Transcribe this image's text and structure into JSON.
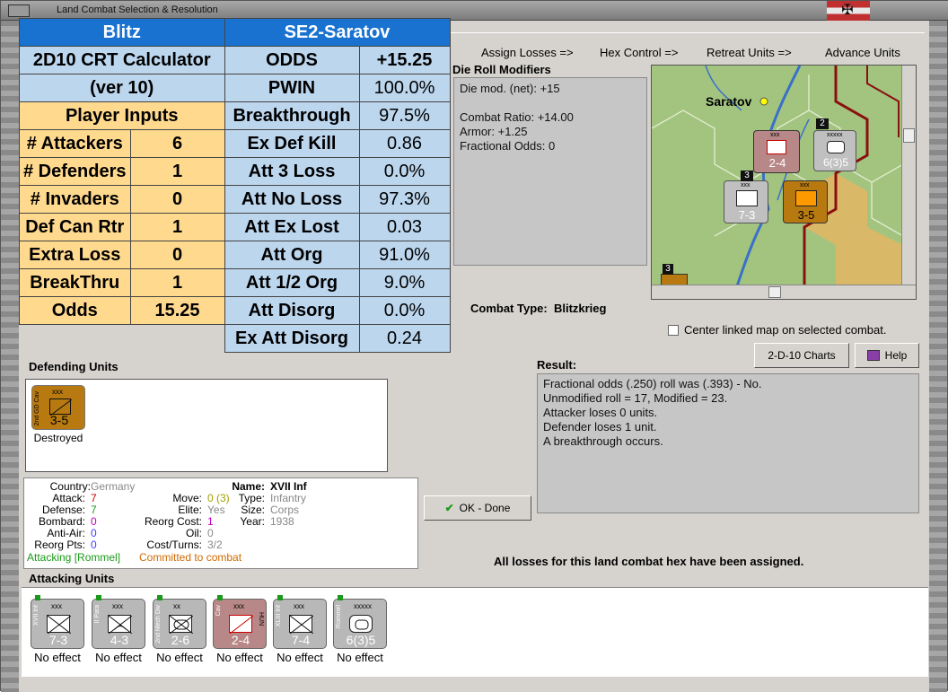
{
  "window": {
    "title": "Land Combat Selection & Resolution"
  },
  "calc": {
    "header_left": "Blitz",
    "header_right": "SE2-Saratov",
    "name_line1": "2D10 CRT Calculator",
    "name_line2": "(ver 10)",
    "inputs_header": "Player Inputs",
    "inputs": [
      {
        "label": "# Attackers",
        "value": "6"
      },
      {
        "label": "# Defenders",
        "value": "1"
      },
      {
        "label": "# Invaders",
        "value": "0"
      },
      {
        "label": "Def Can Rtr",
        "value": "1"
      },
      {
        "label": "Extra Loss",
        "value": "0"
      },
      {
        "label": "BreakThru",
        "value": "1"
      },
      {
        "label": "Odds",
        "value": "15.25"
      }
    ],
    "results": [
      {
        "label": "ODDS",
        "value": "+15.25"
      },
      {
        "label": "PWIN",
        "value": "100.0%"
      },
      {
        "label": "Breakthrough",
        "value": "97.5%"
      },
      {
        "label": "Ex Def Kill",
        "value": "0.86"
      },
      {
        "label": "Att 3 Loss",
        "value": "0.0%"
      },
      {
        "label": "Att No Loss",
        "value": "97.3%"
      },
      {
        "label": "Att Ex Lost",
        "value": "0.03"
      },
      {
        "label": "Att Org",
        "value": "91.0%"
      },
      {
        "label": "Att 1/2 Org",
        "value": "9.0%"
      },
      {
        "label": "Att Disorg",
        "value": "0.0%"
      },
      {
        "label": "Ex Att Disorg",
        "value": "0.24"
      }
    ]
  },
  "steps": [
    "Assign Losses =>",
    "Hex Control =>",
    "Retreat Units =>",
    "Advance Units"
  ],
  "drm": {
    "title": "Die Roll Modifiers",
    "lines": [
      "Die mod. (net): +15",
      "",
      "Combat Ratio: +14.00",
      "Armor: +1.25",
      "Fractional Odds: 0"
    ]
  },
  "map": {
    "city": "Saratov",
    "stack_counts": [
      "2",
      "3",
      "3"
    ],
    "units": [
      {
        "top": "xxx",
        "value": "2-4"
      },
      {
        "top": "xxxxx",
        "value": "6(3)5"
      },
      {
        "top": "xxx",
        "value": "7-3"
      },
      {
        "top": "xxx",
        "value": "3-5"
      }
    ]
  },
  "combat_type": {
    "label": "Combat Type:",
    "value": "Blitzkrieg"
  },
  "center_map_label": "Center linked map on selected combat.",
  "buttons": {
    "charts": "2-D-10 Charts",
    "help": "Help",
    "ok": "OK - Done"
  },
  "defending": {
    "title": "Defending Units",
    "units": [
      {
        "side": "2nd GD Cav",
        "top": "xxx",
        "value": "3-5",
        "status": "Destroyed"
      }
    ]
  },
  "info": {
    "country_label": "Country:",
    "country": "Germany",
    "attack_label": "Attack:",
    "attack": "7",
    "defense_label": "Defense:",
    "defense": "7",
    "bombard_label": "Bombard:",
    "bombard": "0",
    "antiair_label": "Anti-Air:",
    "antiair": "0",
    "reorg_pts_label": "Reorg Pts:",
    "reorg_pts": "0",
    "move_label": "Move:",
    "move": "0 (3)",
    "elite_label": "Elite:",
    "elite": "Yes",
    "reorg_cost_label": "Reorg Cost:",
    "reorg_cost": "1",
    "oil_label": "Oil:",
    "oil": "0",
    "cost_turns_label": "Cost/Turns:",
    "cost_turns": "3/2",
    "name_label": "Name:",
    "name": "XVII Inf",
    "type_label": "Type:",
    "type": "Infantry",
    "size_label": "Size:",
    "size": "Corps",
    "year_label": "Year:",
    "year": "1938",
    "attacking": "Attacking [Rommel]",
    "committed": "Committed to combat"
  },
  "result": {
    "title": "Result:",
    "lines": [
      "Fractional odds (.250) roll was (.393)  - No.",
      "Unmodified roll = 17, Modified = 23.",
      "Attacker loses 0 units.",
      "Defender loses 1 unit.",
      "A breakthrough occurs."
    ]
  },
  "all_losses": "All losses for this land combat hex have been assigned.",
  "attacking": {
    "title": "Attacking Units",
    "units": [
      {
        "side": "XVII Inf",
        "top": "xxx",
        "value": "7-3",
        "status": "No effect"
      },
      {
        "side": "II Para",
        "top": "xxx",
        "value": "4-3",
        "status": "No effect"
      },
      {
        "side": "2nd Mech Div",
        "top": "xx",
        "value": "2-6",
        "status": "No effect"
      },
      {
        "side": "Cav",
        "top": "xxx",
        "value": "2-4",
        "status": "No effect",
        "nation": "HUN"
      },
      {
        "side": "XLIII Inf",
        "top": "xxx",
        "value": "7-4",
        "status": "No effect"
      },
      {
        "side": "Rommel",
        "top": "xxxxx",
        "value": "6(3)5",
        "status": "No effect"
      }
    ]
  },
  "colors": {
    "calc_header": "#1a72d0",
    "calc_blue": "#bcd6ee",
    "calc_tan": "#ffd98e",
    "defender": "#b87a10",
    "attack_red": "#cc0000",
    "committed": "#d06a00",
    "attacking_green": "#1a9a1a"
  }
}
